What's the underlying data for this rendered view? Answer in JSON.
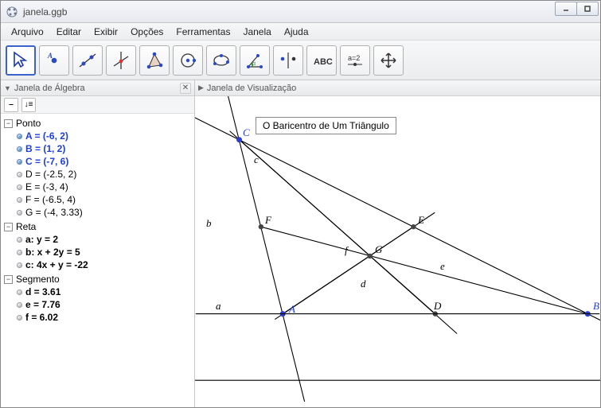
{
  "window": {
    "title": "janela.ggb"
  },
  "menu": {
    "arquivo": "Arquivo",
    "editar": "Editar",
    "exibir": "Exibir",
    "opcoes": "Opções",
    "ferramentas": "Ferramentas",
    "janela": "Janela",
    "ajuda": "Ajuda"
  },
  "toolbar": {
    "tools": [
      "move",
      "point",
      "line",
      "perpendicular",
      "polygon",
      "circle",
      "conic",
      "angle",
      "reflection",
      "text",
      "slider",
      "move-view"
    ]
  },
  "algebra": {
    "title": "Janela de Álgebra",
    "groups": [
      {
        "name": "Ponto",
        "items": [
          {
            "label": "A = (-6, 2)",
            "color": "blue"
          },
          {
            "label": "B = (1, 2)",
            "color": "blue"
          },
          {
            "label": "C = (-7, 6)",
            "color": "blue"
          },
          {
            "label": "D = (-2.5, 2)",
            "color": "black"
          },
          {
            "label": "E = (-3, 4)",
            "color": "black"
          },
          {
            "label": "F = (-6.5, 4)",
            "color": "black"
          },
          {
            "label": "G = (-4, 3.33)",
            "color": "black"
          }
        ]
      },
      {
        "name": "Reta",
        "items": [
          {
            "label": "a: y = 2",
            "color": "black",
            "bold": true
          },
          {
            "label": "b: x + 2y = 5",
            "color": "black",
            "bold": true
          },
          {
            "label": "c: 4x + y = -22",
            "color": "black",
            "bold": true
          }
        ]
      },
      {
        "name": "Segmento",
        "items": [
          {
            "label": "d = 3.61",
            "color": "black",
            "bold": true
          },
          {
            "label": "e = 7.76",
            "color": "black",
            "bold": true
          },
          {
            "label": "f = 6.02",
            "color": "black",
            "bold": true
          }
        ]
      }
    ]
  },
  "graphics": {
    "title": "Janela de Visualização",
    "caption": "O Baricentro de Um Triângulo",
    "labels": {
      "A": "A",
      "B": "B",
      "C": "C",
      "D": "D",
      "E": "E",
      "F": "F",
      "G": "G",
      "a": "a",
      "b": "b",
      "c": "c",
      "d": "d",
      "e": "e",
      "f": "f"
    }
  },
  "chart_data": {
    "type": "diagram",
    "title": "O Baricentro de Um Triângulo",
    "points": {
      "A": [
        -6,
        2
      ],
      "B": [
        1,
        2
      ],
      "C": [
        -7,
        6
      ],
      "D": [
        -2.5,
        2
      ],
      "E": [
        -3,
        4
      ],
      "F": [
        -6.5,
        4
      ],
      "G": [
        -4,
        3.33
      ]
    },
    "lines": {
      "a": "y = 2",
      "b": "x + 2y = 5",
      "c": "4x + y = -22"
    },
    "segments": {
      "d": 3.61,
      "e": 7.76,
      "f": 6.02
    }
  }
}
